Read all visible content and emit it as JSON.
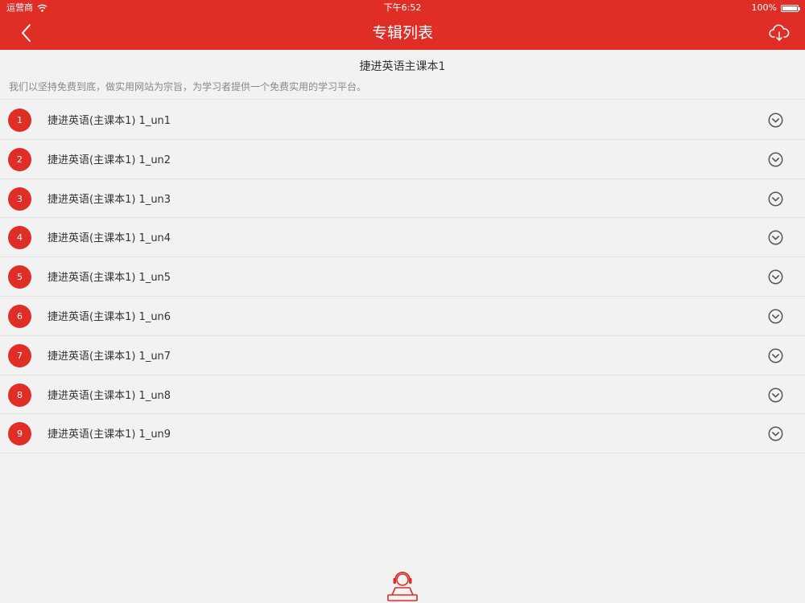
{
  "status_bar": {
    "carrier": "运营商",
    "time": "下午6:52",
    "battery": "100%"
  },
  "nav": {
    "title": "专辑列表",
    "back_icon": "chevron-left-icon",
    "cloud_icon": "cloud-download-icon"
  },
  "album": {
    "title": "捷进英语主课本1",
    "description": "我们以坚持免费到底，做实用网站为宗旨，为学习者提供一个免费实用的学习平台。"
  },
  "tracks": [
    {
      "number": "1",
      "title": "捷进英语(主课本1)  1_un1"
    },
    {
      "number": "2",
      "title": "捷进英语(主课本1)  1_un2"
    },
    {
      "number": "3",
      "title": "捷进英语(主课本1)  1_un3"
    },
    {
      "number": "4",
      "title": "捷进英语(主课本1)  1_un4"
    },
    {
      "number": "5",
      "title": "捷进英语(主课本1)  1_un5"
    },
    {
      "number": "6",
      "title": "捷进英语(主课本1)  1_un6"
    },
    {
      "number": "7",
      "title": "捷进英语(主课本1)  1_un7"
    },
    {
      "number": "8",
      "title": "捷进英语(主课本1)  1_un8"
    },
    {
      "number": "9",
      "title": "捷进英语(主课本1)  1_un9"
    }
  ],
  "colors": {
    "accent": "#e02e27",
    "background": "#f2f2f2"
  }
}
